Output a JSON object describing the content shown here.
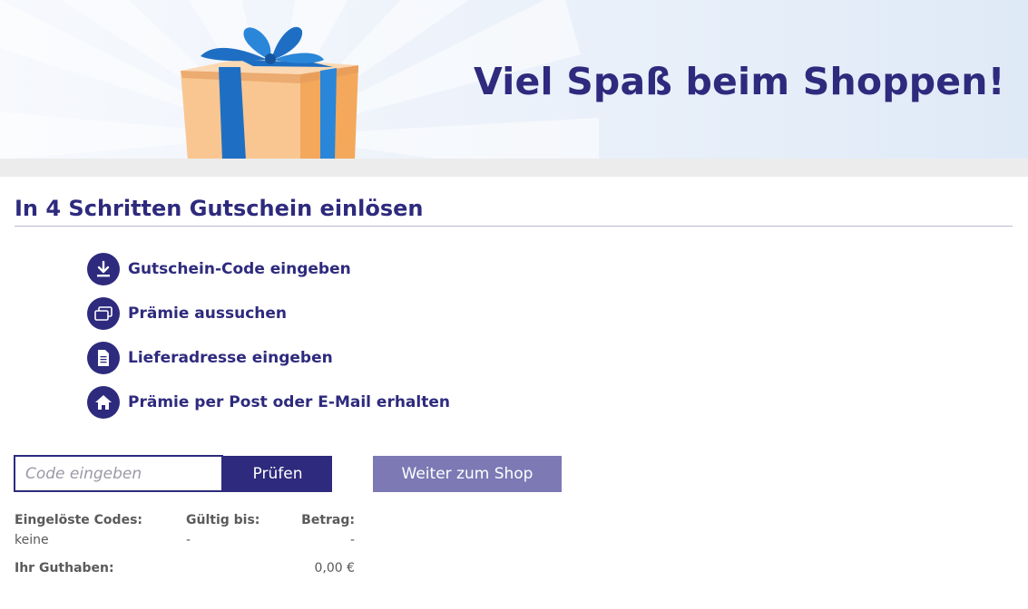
{
  "banner": {
    "headline": "Viel Spaß beim Shoppen!",
    "gift_icon": "gift-box-illustration",
    "colors": {
      "ribbon": "#1e6fc4",
      "box": "#f7b26b"
    }
  },
  "steps": {
    "title": "In 4 Schritten Gutschein einlösen",
    "items": [
      {
        "label": "Gutschein-Code eingeben",
        "icon": "download-icon"
      },
      {
        "label": "Prämie aussuchen",
        "icon": "cards-icon"
      },
      {
        "label": "Lieferadresse eingeben",
        "icon": "document-icon"
      },
      {
        "label": "Prämie per Post oder E-Mail erhalten",
        "icon": "home-icon"
      }
    ]
  },
  "form": {
    "code_placeholder": "Code eingeben",
    "code_value": "",
    "check_label": "Prüfen",
    "shop_label": "Weiter zum Shop"
  },
  "codes": {
    "col_codes": "Eingelöste Codes:",
    "col_valid": "Gültig bis:",
    "col_amount": "Betrag:",
    "row": {
      "code": "keine",
      "valid": "-",
      "amount": "-"
    },
    "balance_label": "Ihr Guthaben:",
    "balance_value": "0,00 €"
  },
  "colors": {
    "primary": "#2e2a7d",
    "secondary_button": "#7c79b5",
    "separator": "#ececec",
    "muted_text": "#5a5a5a"
  }
}
